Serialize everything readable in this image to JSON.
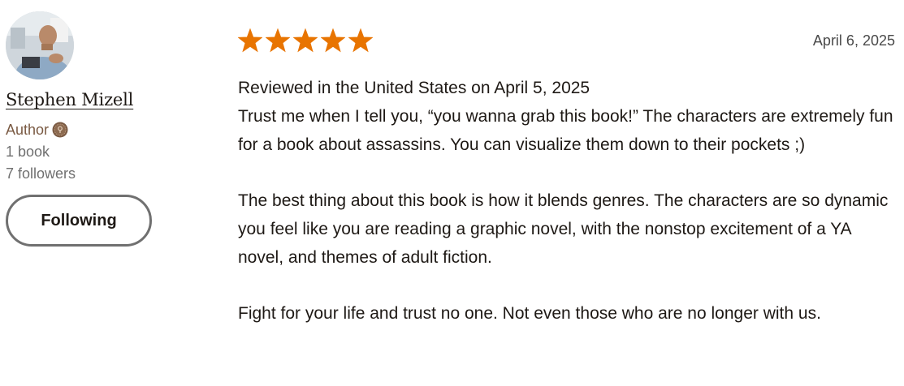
{
  "reviewer": {
    "name": "Stephen Mizell",
    "role": "Author",
    "books": "1 book",
    "followers": "7 followers",
    "follow_button": "Following",
    "avatar_icon": "user-photo-avatar",
    "badge_icon": "author-badge-icon"
  },
  "review": {
    "rating": 5,
    "rating_max": 5,
    "date": "April 6, 2025",
    "paragraphs": [
      "Reviewed in the United States on April 5, 2025",
      "Trust me when I tell you, “you wanna grab this book!” The characters are extremely fun for a book about assassins. You can visualize them down to their pockets ;)",
      "The best thing about this book is how it blends genres. The characters are so dynamic you feel like you are reading a graphic novel, with the nonstop excitement of a YA novel, and themes of adult fiction.",
      "Fight for your life and trust no one. Not even those who are no longer with us."
    ]
  },
  "colors": {
    "star": "#e87400",
    "author_text": "#7a5a43",
    "meta_text": "#707070",
    "body_text": "#1e1915",
    "button_border": "#707070"
  }
}
